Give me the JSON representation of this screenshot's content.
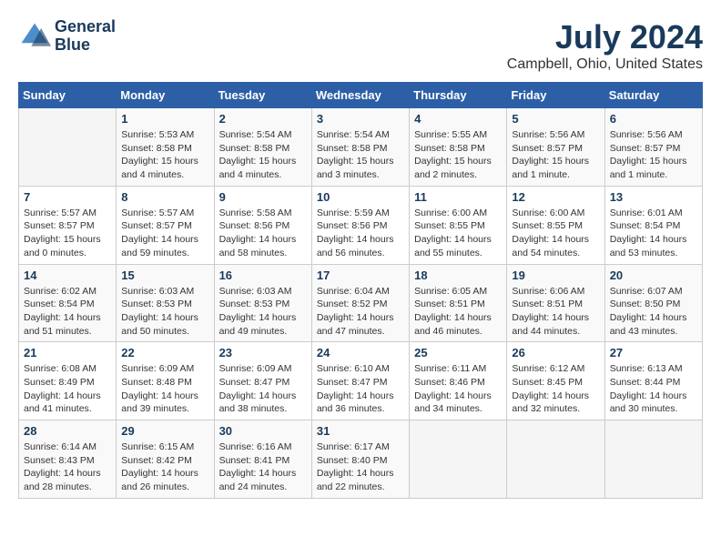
{
  "logo": {
    "line1": "General",
    "line2": "Blue"
  },
  "title": "July 2024",
  "subtitle": "Campbell, Ohio, United States",
  "days_of_week": [
    "Sunday",
    "Monday",
    "Tuesday",
    "Wednesday",
    "Thursday",
    "Friday",
    "Saturday"
  ],
  "weeks": [
    [
      {
        "day": "",
        "info": ""
      },
      {
        "day": "1",
        "info": "Sunrise: 5:53 AM\nSunset: 8:58 PM\nDaylight: 15 hours\nand 4 minutes."
      },
      {
        "day": "2",
        "info": "Sunrise: 5:54 AM\nSunset: 8:58 PM\nDaylight: 15 hours\nand 4 minutes."
      },
      {
        "day": "3",
        "info": "Sunrise: 5:54 AM\nSunset: 8:58 PM\nDaylight: 15 hours\nand 3 minutes."
      },
      {
        "day": "4",
        "info": "Sunrise: 5:55 AM\nSunset: 8:58 PM\nDaylight: 15 hours\nand 2 minutes."
      },
      {
        "day": "5",
        "info": "Sunrise: 5:56 AM\nSunset: 8:57 PM\nDaylight: 15 hours\nand 1 minute."
      },
      {
        "day": "6",
        "info": "Sunrise: 5:56 AM\nSunset: 8:57 PM\nDaylight: 15 hours\nand 1 minute."
      }
    ],
    [
      {
        "day": "7",
        "info": "Sunrise: 5:57 AM\nSunset: 8:57 PM\nDaylight: 15 hours\nand 0 minutes."
      },
      {
        "day": "8",
        "info": "Sunrise: 5:57 AM\nSunset: 8:57 PM\nDaylight: 14 hours\nand 59 minutes."
      },
      {
        "day": "9",
        "info": "Sunrise: 5:58 AM\nSunset: 8:56 PM\nDaylight: 14 hours\nand 58 minutes."
      },
      {
        "day": "10",
        "info": "Sunrise: 5:59 AM\nSunset: 8:56 PM\nDaylight: 14 hours\nand 56 minutes."
      },
      {
        "day": "11",
        "info": "Sunrise: 6:00 AM\nSunset: 8:55 PM\nDaylight: 14 hours\nand 55 minutes."
      },
      {
        "day": "12",
        "info": "Sunrise: 6:00 AM\nSunset: 8:55 PM\nDaylight: 14 hours\nand 54 minutes."
      },
      {
        "day": "13",
        "info": "Sunrise: 6:01 AM\nSunset: 8:54 PM\nDaylight: 14 hours\nand 53 minutes."
      }
    ],
    [
      {
        "day": "14",
        "info": "Sunrise: 6:02 AM\nSunset: 8:54 PM\nDaylight: 14 hours\nand 51 minutes."
      },
      {
        "day": "15",
        "info": "Sunrise: 6:03 AM\nSunset: 8:53 PM\nDaylight: 14 hours\nand 50 minutes."
      },
      {
        "day": "16",
        "info": "Sunrise: 6:03 AM\nSunset: 8:53 PM\nDaylight: 14 hours\nand 49 minutes."
      },
      {
        "day": "17",
        "info": "Sunrise: 6:04 AM\nSunset: 8:52 PM\nDaylight: 14 hours\nand 47 minutes."
      },
      {
        "day": "18",
        "info": "Sunrise: 6:05 AM\nSunset: 8:51 PM\nDaylight: 14 hours\nand 46 minutes."
      },
      {
        "day": "19",
        "info": "Sunrise: 6:06 AM\nSunset: 8:51 PM\nDaylight: 14 hours\nand 44 minutes."
      },
      {
        "day": "20",
        "info": "Sunrise: 6:07 AM\nSunset: 8:50 PM\nDaylight: 14 hours\nand 43 minutes."
      }
    ],
    [
      {
        "day": "21",
        "info": "Sunrise: 6:08 AM\nSunset: 8:49 PM\nDaylight: 14 hours\nand 41 minutes."
      },
      {
        "day": "22",
        "info": "Sunrise: 6:09 AM\nSunset: 8:48 PM\nDaylight: 14 hours\nand 39 minutes."
      },
      {
        "day": "23",
        "info": "Sunrise: 6:09 AM\nSunset: 8:47 PM\nDaylight: 14 hours\nand 38 minutes."
      },
      {
        "day": "24",
        "info": "Sunrise: 6:10 AM\nSunset: 8:47 PM\nDaylight: 14 hours\nand 36 minutes."
      },
      {
        "day": "25",
        "info": "Sunrise: 6:11 AM\nSunset: 8:46 PM\nDaylight: 14 hours\nand 34 minutes."
      },
      {
        "day": "26",
        "info": "Sunrise: 6:12 AM\nSunset: 8:45 PM\nDaylight: 14 hours\nand 32 minutes."
      },
      {
        "day": "27",
        "info": "Sunrise: 6:13 AM\nSunset: 8:44 PM\nDaylight: 14 hours\nand 30 minutes."
      }
    ],
    [
      {
        "day": "28",
        "info": "Sunrise: 6:14 AM\nSunset: 8:43 PM\nDaylight: 14 hours\nand 28 minutes."
      },
      {
        "day": "29",
        "info": "Sunrise: 6:15 AM\nSunset: 8:42 PM\nDaylight: 14 hours\nand 26 minutes."
      },
      {
        "day": "30",
        "info": "Sunrise: 6:16 AM\nSunset: 8:41 PM\nDaylight: 14 hours\nand 24 minutes."
      },
      {
        "day": "31",
        "info": "Sunrise: 6:17 AM\nSunset: 8:40 PM\nDaylight: 14 hours\nand 22 minutes."
      },
      {
        "day": "",
        "info": ""
      },
      {
        "day": "",
        "info": ""
      },
      {
        "day": "",
        "info": ""
      }
    ]
  ]
}
